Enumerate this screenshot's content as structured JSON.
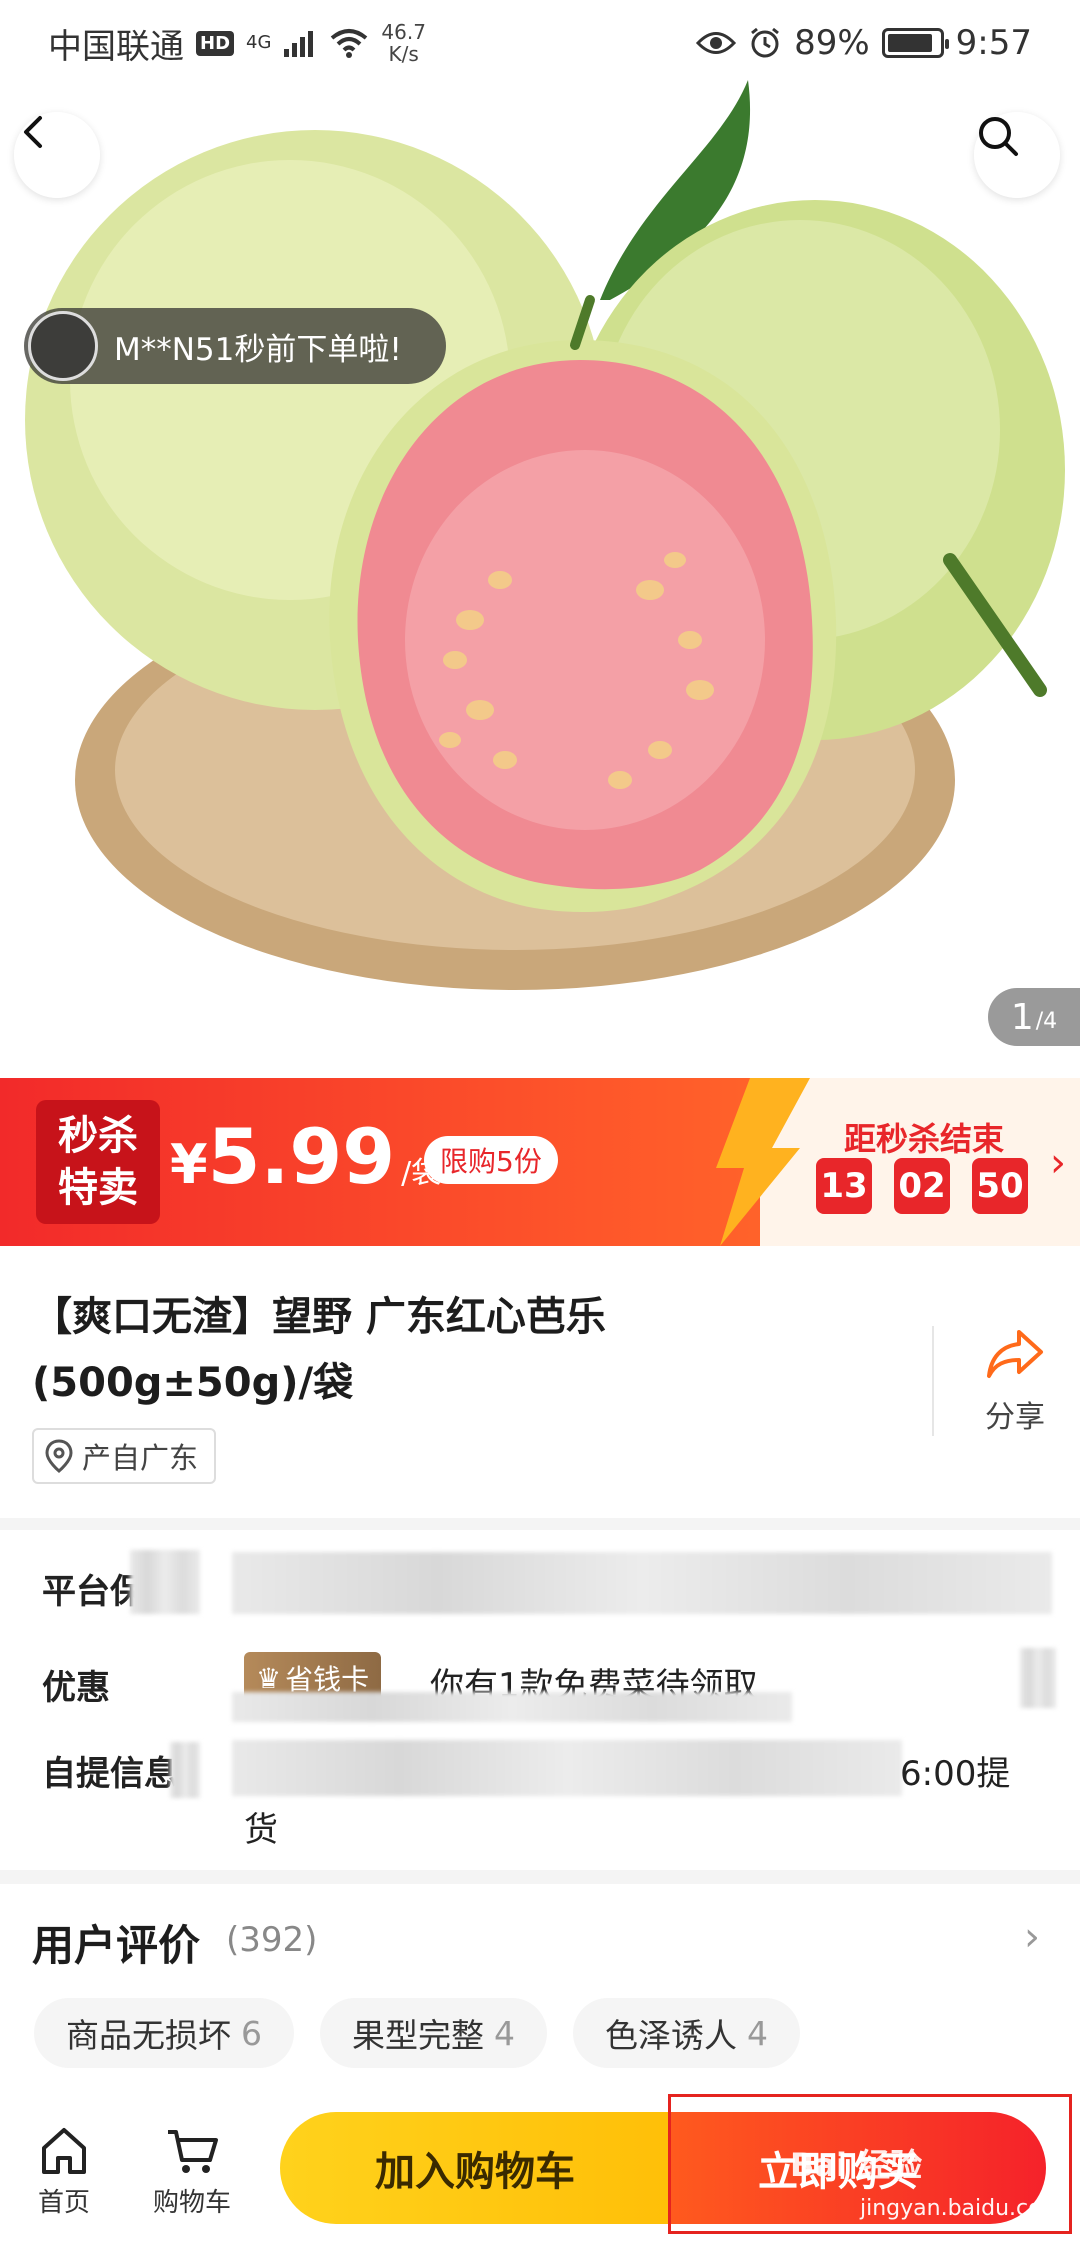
{
  "status_bar": {
    "carrier": "中国联通",
    "hd": "HD",
    "network": "4G",
    "speed_value": "46.7",
    "speed_unit": "K/s",
    "battery": "89%",
    "battery_level": 0.89,
    "time": "9:57"
  },
  "hero": {
    "toast": "M**N51秒前下单啦!",
    "page_current": "1",
    "page_total": "/4"
  },
  "flash_sale": {
    "tag_line1": "秒杀",
    "tag_line2": "特卖",
    "currency": "¥",
    "price": "5.99",
    "unit": "/袋",
    "limit": "限购5份",
    "countdown_title": "距秒杀结束",
    "hours": "13",
    "minutes": "02",
    "seconds": "50",
    "accent": "#e8262a"
  },
  "product": {
    "title": "【爽口无渣】望野 广东红心芭乐 (500g±50g)/袋",
    "origin": "产自广东",
    "share_label": "分享"
  },
  "services": {
    "platform_label": "平台保",
    "discount_label": "优惠",
    "vip_badge": "省钱卡",
    "coupon_text": "你有1款免费菜待领取",
    "pickup_label": "自提信息",
    "pickup_time_tail": "6:00提",
    "pickup_line2": "货"
  },
  "reviews": {
    "title": "用户评价",
    "count": "(392)",
    "tags": [
      {
        "label": "商品无损坏",
        "count": "6"
      },
      {
        "label": "果型完整",
        "count": "4"
      },
      {
        "label": "色泽诱人",
        "count": "4"
      }
    ]
  },
  "bottom_bar": {
    "home": "首页",
    "cart": "购物车",
    "add_to_cart": "加入购物车",
    "buy_now": "立即购买"
  },
  "watermark": {
    "brand": "Bai 经验",
    "url": "jingyan.baidu.com"
  }
}
